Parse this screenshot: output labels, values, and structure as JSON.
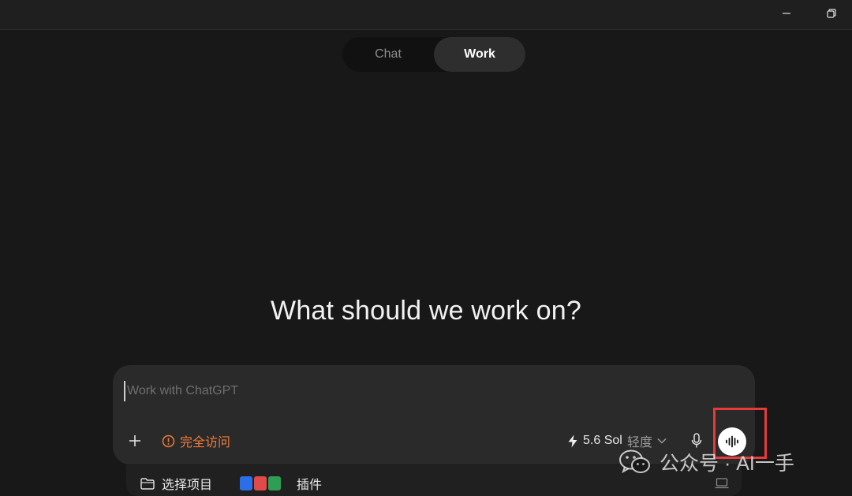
{
  "window": {
    "minimize_icon": "minimize-icon",
    "restore_icon": "restore-icon"
  },
  "mode_switch": {
    "chat_label": "Chat",
    "work_label": "Work",
    "active": "Work"
  },
  "main": {
    "headline": "What should we work on?"
  },
  "composer": {
    "placeholder": "Work with ChatGPT",
    "add_icon": "plus-icon",
    "access_label": "完全访问",
    "access_icon": "alert-circle-icon",
    "model_name": "5.6 Sol",
    "model_effort": "轻度",
    "model_icon": "lightning-icon",
    "mic_icon": "microphone-icon",
    "voice_icon": "waveform-icon"
  },
  "subbar": {
    "project_label": "选择项目",
    "project_icon": "folder-icon",
    "plugins_label": "插件",
    "laptop_icon": "laptop-icon"
  },
  "watermark": {
    "text": "公众号 · AI一手",
    "icon": "wechat-icon"
  },
  "colors": {
    "background": "#181818",
    "composer": "#2a2a2a",
    "access_orange": "#f07a3a",
    "highlight_red": "#e53b3b"
  }
}
